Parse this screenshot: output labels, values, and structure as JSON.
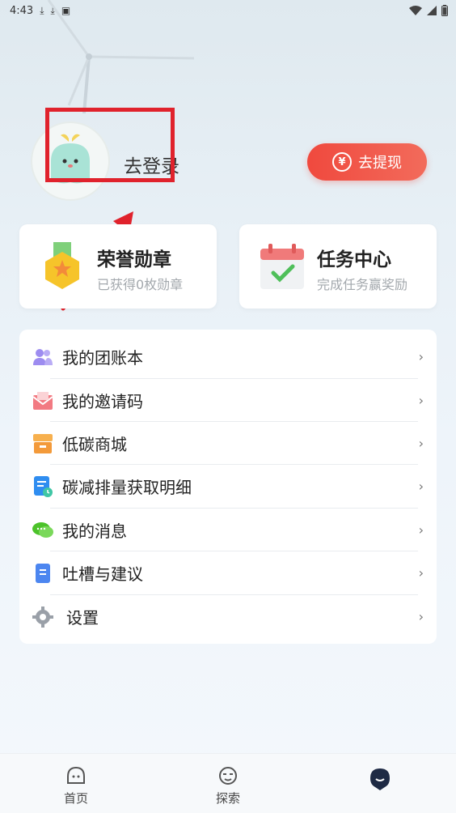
{
  "status_bar": {
    "time": "4:43"
  },
  "profile": {
    "login_text": "去登录",
    "withdraw_label": "去提现",
    "withdraw_icon": "yuan-coin-icon"
  },
  "cards": {
    "honor": {
      "title": "荣誉勋章",
      "subtitle": "已获得0枚勋章",
      "icon": "medal-icon"
    },
    "task": {
      "title": "任务中心",
      "subtitle": "完成任务赢奖励",
      "icon": "calendar-check-icon"
    }
  },
  "menu": {
    "items": [
      {
        "label": "我的团账本",
        "icon": "group-icon",
        "color": "#8a7be8"
      },
      {
        "label": "我的邀请码",
        "icon": "envelope-icon",
        "color": "#f0626a"
      },
      {
        "label": "低碳商城",
        "icon": "store-icon",
        "color": "#f39a3a"
      },
      {
        "label": "碳减排量获取明细",
        "icon": "detail-doc-icon",
        "color": "#2f8df0"
      },
      {
        "label": "我的消息",
        "icon": "chat-icon",
        "color": "#55c62b"
      },
      {
        "label": "吐槽与建议",
        "icon": "note-icon",
        "color": "#4c86f0"
      },
      {
        "label": "设置",
        "icon": "gear-icon",
        "color": "#8a8f98"
      }
    ]
  },
  "tabbar": {
    "tabs": [
      {
        "label": "首页",
        "icon": "home-face-icon"
      },
      {
        "label": "探索",
        "icon": "explore-face-icon"
      },
      {
        "label": "",
        "icon": "profile-face-icon"
      }
    ]
  },
  "colors": {
    "accent": "#f0493e",
    "annotation": "#e0222c"
  }
}
